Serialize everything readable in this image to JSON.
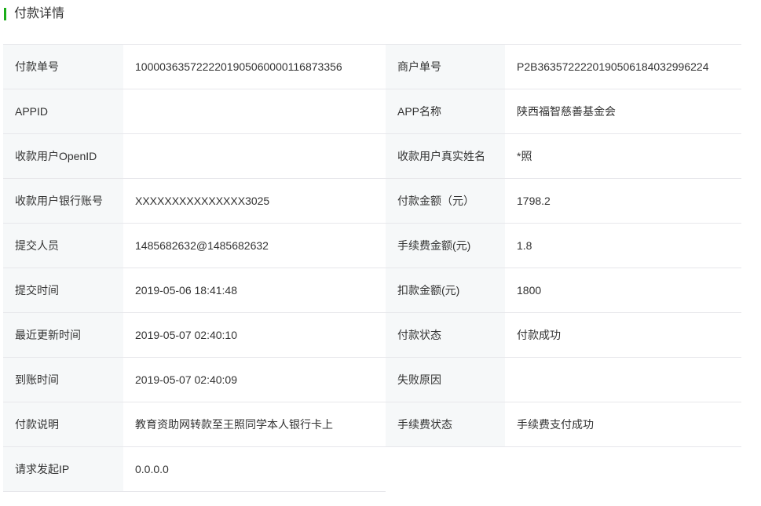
{
  "section": {
    "title": "付款详情",
    "accent_color": "#1aad19"
  },
  "rows": [
    {
      "l1": "付款单号",
      "v1": "1000036357222201905060000116873356",
      "l2": "商户单号",
      "v2": "P2B3635722220190506184032996224"
    },
    {
      "l1": "APPID",
      "v1": "",
      "l2": "APP名称",
      "v2": "陕西福智慈善基金会"
    },
    {
      "l1": "收款用户OpenID",
      "v1": "",
      "l2": "收款用户真实姓名",
      "v2": "*照"
    },
    {
      "l1": "收款用户银行账号",
      "v1": "XXXXXXXXXXXXXXX3025",
      "l2": "付款金额（元）",
      "v2": "1798.2"
    },
    {
      "l1": "提交人员",
      "v1": "1485682632@1485682632",
      "l2": "手续费金额(元)",
      "v2": "1.8"
    },
    {
      "l1": "提交时间",
      "v1": "2019-05-06 18:41:48",
      "l2": "扣款金额(元)",
      "v2": "1800"
    },
    {
      "l1": "最近更新时间",
      "v1": "2019-05-07 02:40:10",
      "l2": "付款状态",
      "v2": "付款成功"
    },
    {
      "l1": "到账时间",
      "v1": "2019-05-07 02:40:09",
      "l2": "失败原因",
      "v2": ""
    },
    {
      "l1": "付款说明",
      "v1": "教育资助网转款至王照同学本人银行卡上",
      "l2": "手续费状态",
      "v2": "手续费支付成功"
    },
    {
      "l1": "请求发起IP",
      "v1": "0.0.0.0"
    }
  ]
}
